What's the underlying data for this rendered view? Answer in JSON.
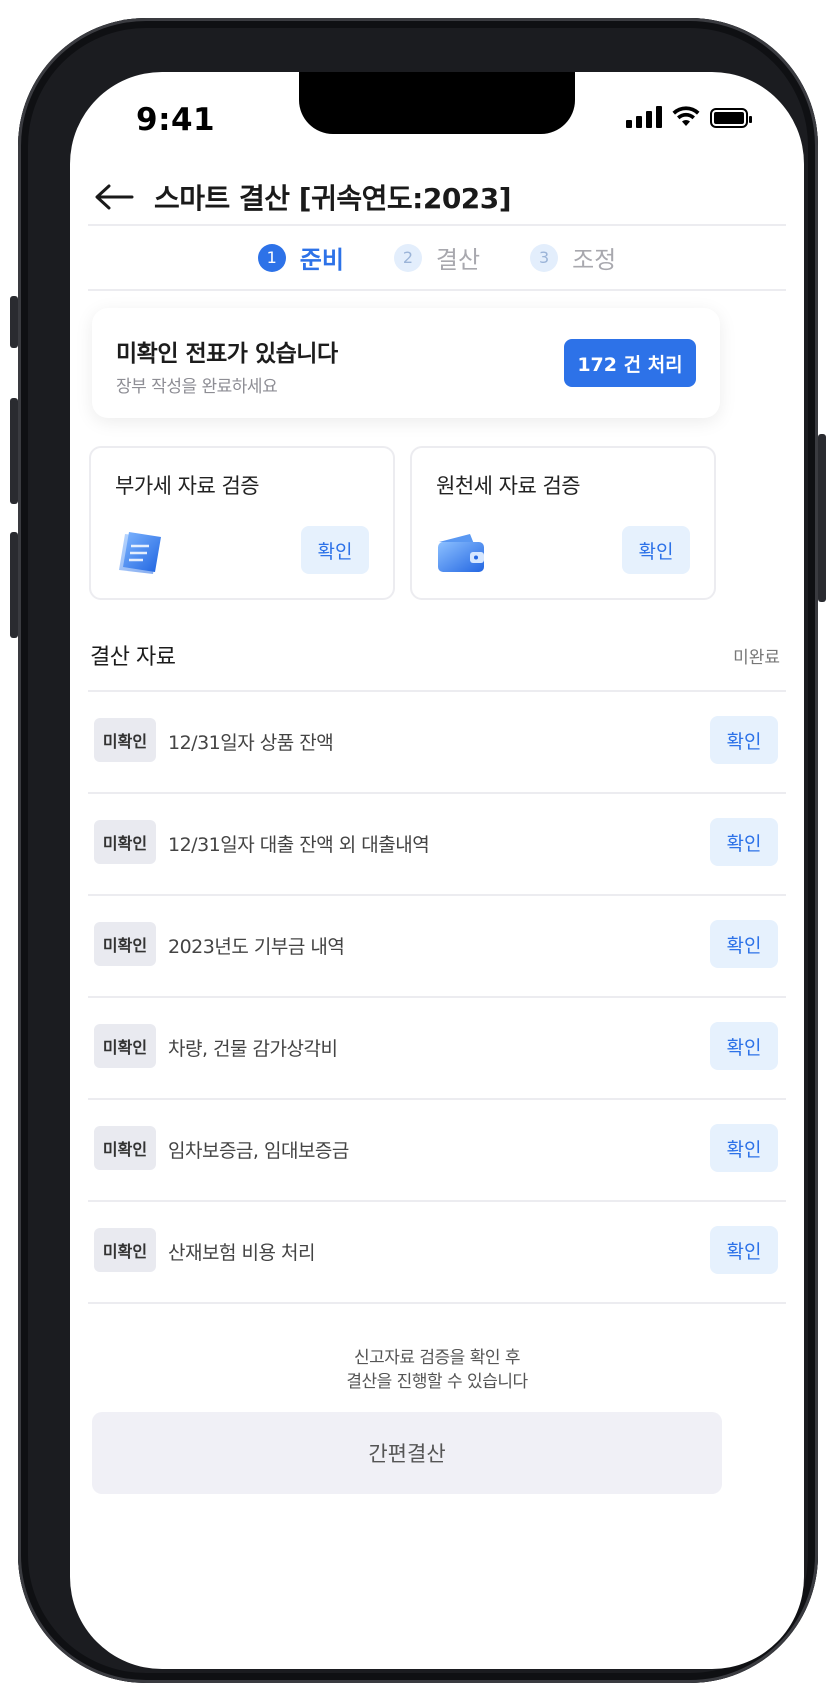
{
  "status_bar": {
    "time": "9:41"
  },
  "header": {
    "title": "스마트 결산 [귀속연도:2023]"
  },
  "steps": [
    {
      "num": "1",
      "label": "준비"
    },
    {
      "num": "2",
      "label": "결산"
    },
    {
      "num": "3",
      "label": "조정"
    }
  ],
  "notice": {
    "heading": "미확인 전표가 있습니다",
    "subtext": "장부 작성을 완료하세요",
    "button": "172 건 처리"
  },
  "verify_cards": [
    {
      "title": "부가세 자료 검증",
      "icon": "document-icon",
      "button": "확인"
    },
    {
      "title": "원천세 자료 검증",
      "icon": "wallet-icon",
      "button": "확인"
    }
  ],
  "section": {
    "title": "결산 자료",
    "status": "미완료"
  },
  "items": [
    {
      "badge": "미확인",
      "label": "12/31일자 상품 잔액",
      "button": "확인"
    },
    {
      "badge": "미확인",
      "label": "12/31일자 대출 잔액 외 대출내역",
      "button": "확인"
    },
    {
      "badge": "미확인",
      "label": "2023년도 기부금 내역",
      "button": "확인"
    },
    {
      "badge": "미확인",
      "label": "차량, 건물 감가상각비",
      "button": "확인"
    },
    {
      "badge": "미확인",
      "label": "임차보증금, 임대보증금",
      "button": "확인"
    },
    {
      "badge": "미확인",
      "label": "산재보험 비용 처리",
      "button": "확인"
    }
  ],
  "footnote": {
    "line1": "신고자료 검증을 확인 후",
    "line2": "결산을 진행할 수 있습니다"
  },
  "main_button": "간편결산",
  "colors": {
    "accent": "#2d72e8",
    "soft_accent": "#e6f1fd",
    "badge_bg": "#e9eaf0",
    "disabled_button_bg": "#f0f0f6"
  }
}
